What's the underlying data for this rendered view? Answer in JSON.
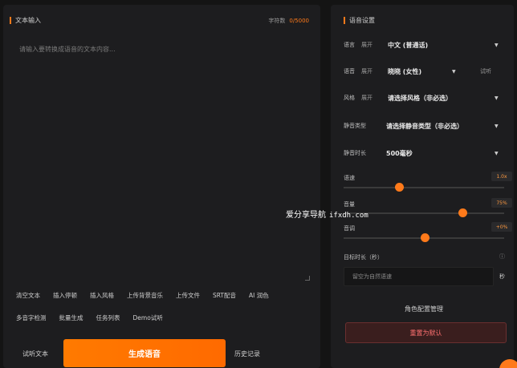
{
  "left": {
    "title": "文本输入",
    "char_count_label": "字符数",
    "char_count_value": "0/5000",
    "placeholder": "请输入要转换成语音的文本内容...",
    "toolbar_row1": [
      "清空文本",
      "插入停顿",
      "插入风格",
      "上传背景音乐",
      "上传文件",
      "SRT配音",
      "AI 润色"
    ],
    "toolbar_row2": [
      "多音字检测",
      "批量生成",
      "任务列表",
      "Demo试听"
    ],
    "listen_text": "试听文本",
    "generate": "生成语音",
    "history": "历史记录"
  },
  "right": {
    "title": "语音设置",
    "language": {
      "label": "语言",
      "expand": "展开",
      "value": "中文 (普通话)"
    },
    "voice": {
      "label": "语音",
      "expand": "展开",
      "value": "晓晓 (女性)",
      "preview": "试听"
    },
    "style": {
      "label": "风格",
      "expand": "展开",
      "value": "请选择风格（非必选）"
    },
    "silence_type": {
      "label": "静音类型",
      "value": "请选择静音类型（非必选）"
    },
    "silence_duration": {
      "label": "静音时长",
      "value": "500毫秒"
    },
    "speed": {
      "label": "语速",
      "value": "1.0x",
      "level": 0.4
    },
    "volume": {
      "label": "音量",
      "value": "75%",
      "level": 0.75
    },
    "pitch": {
      "label": "音调",
      "value": "+0%",
      "level": 0.5
    },
    "target": {
      "label": "目标时长（秒）",
      "placeholder": "留空为自然语速",
      "unit": "秒"
    },
    "role_manage": "角色配置管理",
    "reset": "重置为默认"
  },
  "watermark": {
    "text": "爱分享导航",
    "url": "ifxdh.com"
  },
  "colors": {
    "accent": "#ff7a1a",
    "background": "#141414",
    "panel": "#1d1d1f"
  }
}
